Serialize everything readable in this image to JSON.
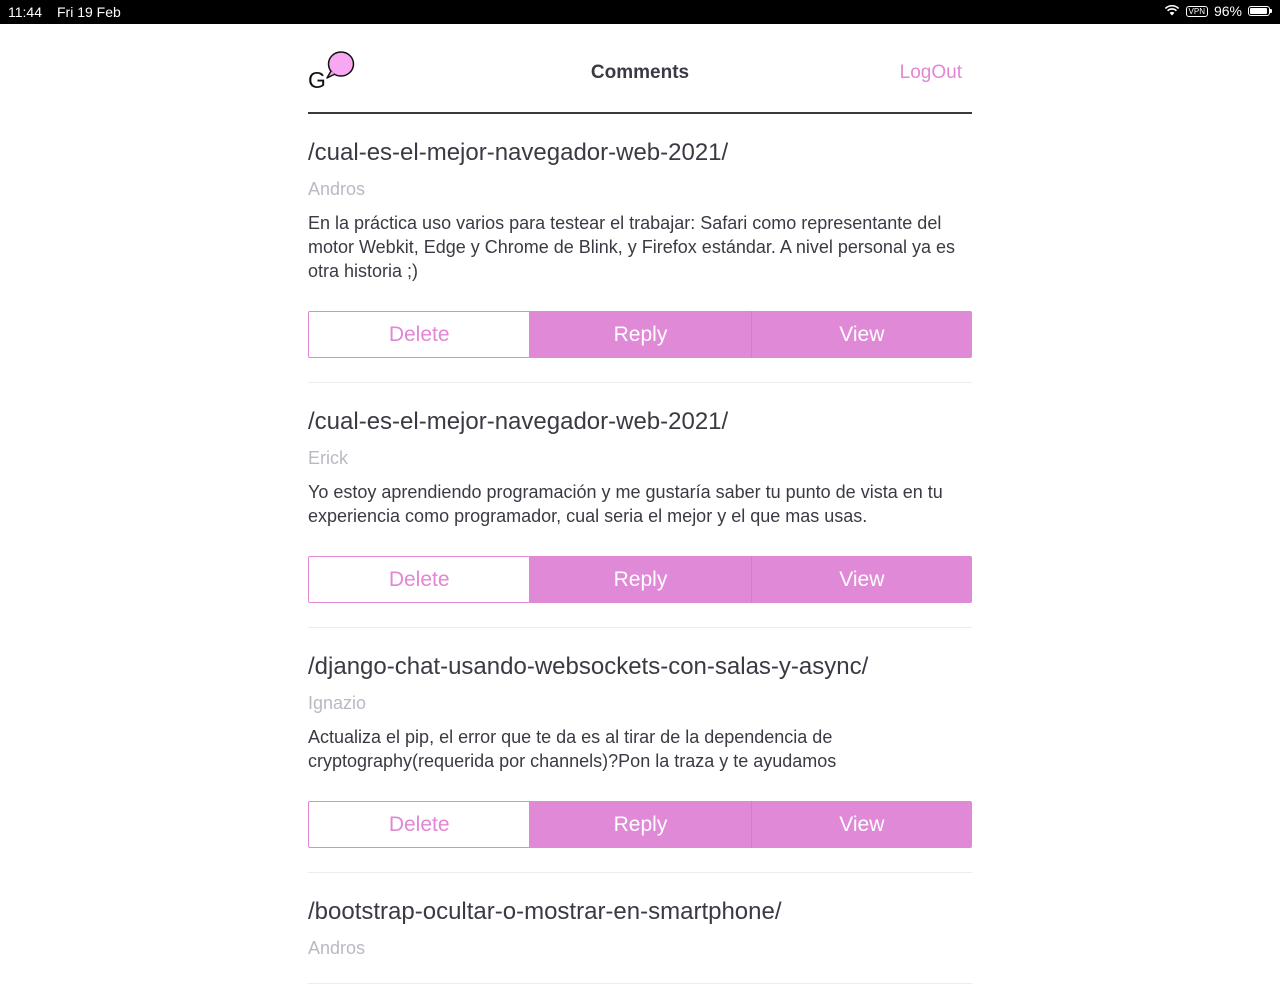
{
  "status_bar": {
    "time": "11:44",
    "date": "Fri 19 Feb",
    "vpn_label": "VPN",
    "battery_text": "96%",
    "battery_level": 0.96,
    "icons": [
      "wifi-icon",
      "vpn-icon",
      "battery-icon"
    ]
  },
  "header": {
    "logo_letter": "G",
    "title": "Comments",
    "logout_label": "LogOut"
  },
  "colors": {
    "accent": "#e286d5",
    "button_fill": "#e08ad7",
    "text": "#3a3a44",
    "muted": "#b9b9c3"
  },
  "comments": [
    {
      "path": "/cual-es-el-mejor-navegador-web-2021/",
      "author": "Andros",
      "text": "En la práctica uso varios para testear el trabajar: Safari como representante del motor Webkit, Edge y Chrome de Blink, y Firefox estándar. A nivel personal ya es otra historia ;)",
      "delete_label": "Delete",
      "reply_label": "Reply",
      "view_label": "View"
    },
    {
      "path": "/cual-es-el-mejor-navegador-web-2021/",
      "author": "Erick",
      "text": "Yo estoy aprendiendo programación y me gustaría saber tu punto de vista en tu experiencia como programador, cual seria el mejor y el que mas usas.",
      "delete_label": "Delete",
      "reply_label": "Reply",
      "view_label": "View"
    },
    {
      "path": "/django-chat-usando-websockets-con-salas-y-async/",
      "author": "Ignazio",
      "text": "Actualiza el pip, el error que te da es al tirar de la dependencia de cryptography(requerida por channels)?Pon la traza y te ayudamos",
      "delete_label": "Delete",
      "reply_label": "Reply",
      "view_label": "View"
    },
    {
      "path": "/bootstrap-ocultar-o-mostrar-en-smartphone/",
      "author": "Andros"
    }
  ]
}
